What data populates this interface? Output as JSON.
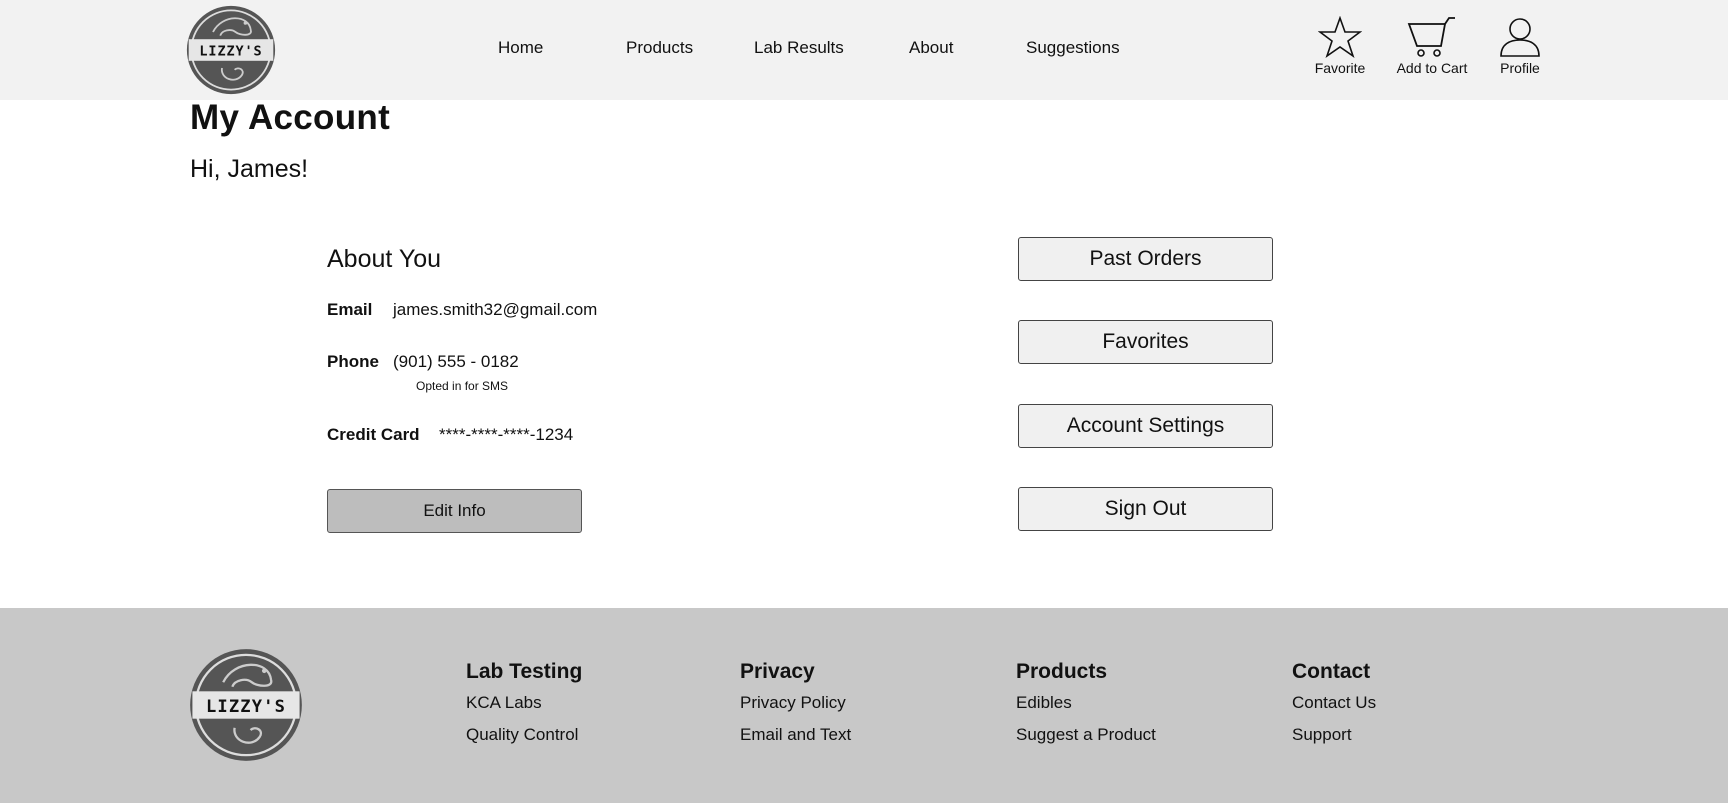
{
  "header": {
    "logo_text": "LIZZY'S",
    "nav": [
      "Home",
      "Products",
      "Lab Results",
      "About",
      "Suggestions"
    ],
    "actions": {
      "favorite": {
        "label": "Favorite",
        "icon": "star-icon"
      },
      "cart": {
        "label": "Add to Cart",
        "icon": "cart-icon"
      },
      "profile": {
        "label": "Profile",
        "icon": "user-icon"
      }
    }
  },
  "main": {
    "title": "My Account",
    "greeting": "Hi, James!",
    "about": {
      "title": "About You",
      "email_label": "Email",
      "email_value": "james.smith32@gmail.com",
      "phone_label": "Phone",
      "phone_value": "(901) 555 - 0182",
      "phone_note": "Opted in for SMS",
      "card_label": "Credit Card",
      "card_value": "****-****-****-1234",
      "edit_button": "Edit Info"
    },
    "side_buttons": [
      "Past Orders",
      "Favorites",
      "Account Settings",
      "Sign Out"
    ]
  },
  "footer": {
    "logo_text": "LIZZY'S",
    "columns": [
      {
        "heading": "Lab Testing",
        "links": [
          "KCA Labs",
          "Quality Control"
        ]
      },
      {
        "heading": "Privacy",
        "links": [
          "Privacy Policy",
          "Email and Text"
        ]
      },
      {
        "heading": "Products",
        "links": [
          "Edibles",
          "Suggest a Product"
        ]
      },
      {
        "heading": "Contact",
        "links": [
          "Contact Us",
          "Support"
        ]
      }
    ]
  },
  "colors": {
    "header_bg": "#f2f2f2",
    "footer_bg": "#c8c8c8",
    "edit_button_bg": "#bdbdbd",
    "side_button_bg": "#f0f0f0",
    "logo_dark": "#555555"
  }
}
